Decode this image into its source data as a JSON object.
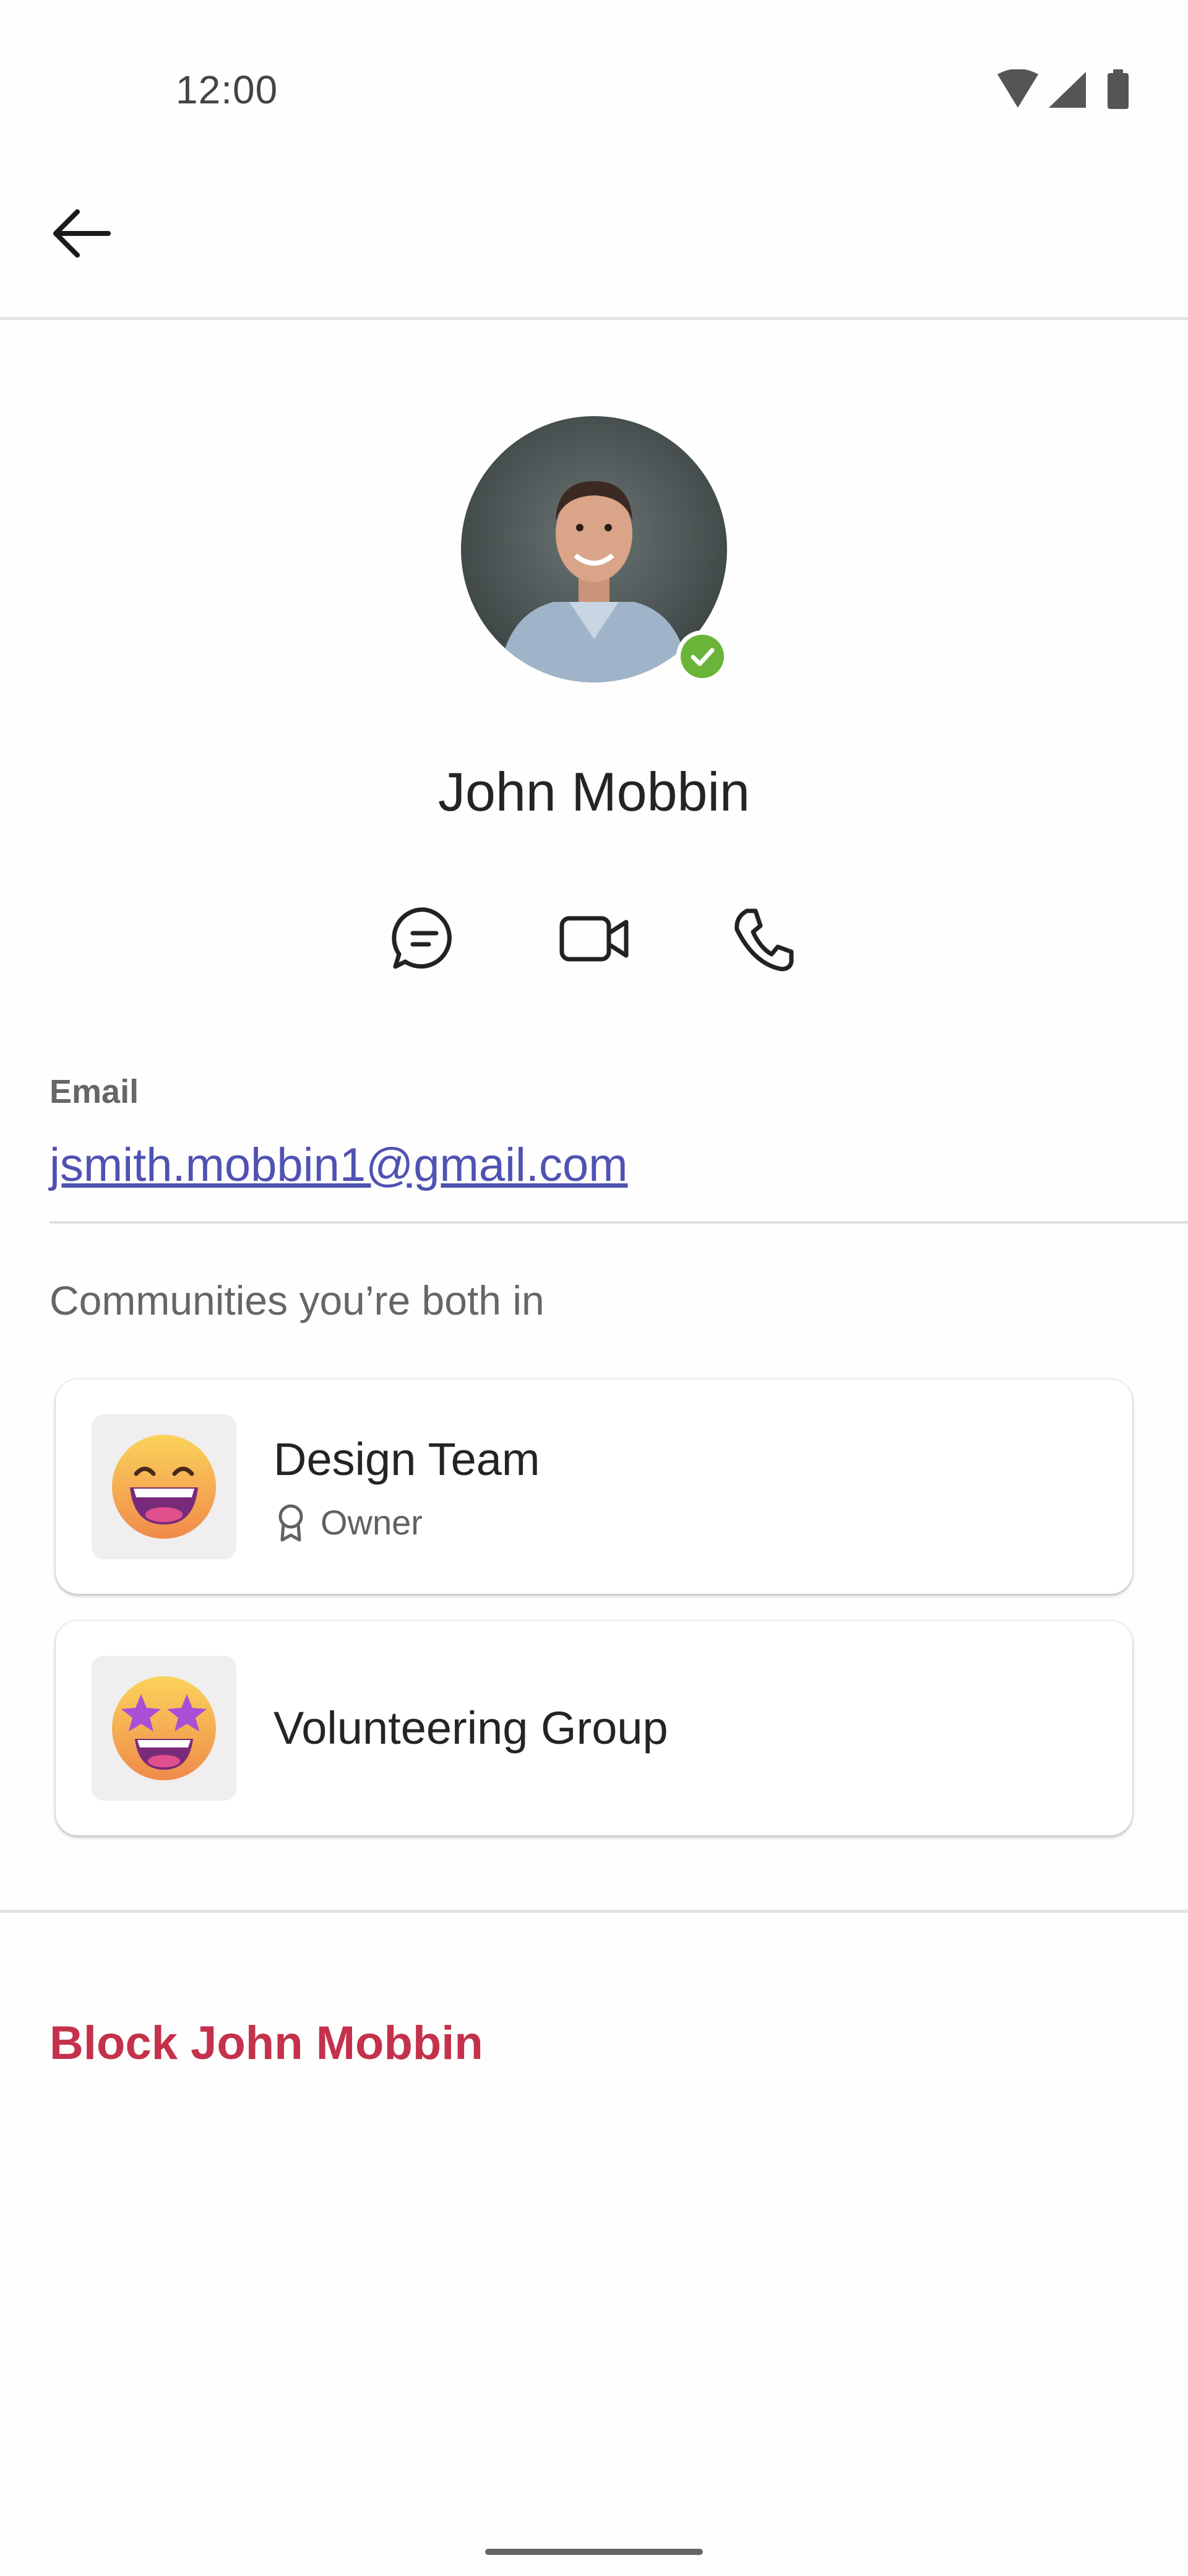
{
  "status_bar": {
    "time": "12:00",
    "icons": [
      "wifi-icon",
      "cellular-signal-icon",
      "battery-icon"
    ]
  },
  "app_bar": {
    "back_icon": "arrow-left-icon"
  },
  "profile": {
    "name": "John Mobbin",
    "presence": "available",
    "presence_color": "#6bb43a"
  },
  "actions": [
    {
      "name": "chat",
      "icon": "chat-icon"
    },
    {
      "name": "video-call",
      "icon": "video-camera-icon"
    },
    {
      "name": "audio-call",
      "icon": "phone-icon"
    }
  ],
  "email": {
    "label": "Email",
    "value": "jsmith.mobbin1@gmail.com",
    "link_color": "#4f52b2"
  },
  "communities": {
    "heading": "Communities you’re both in",
    "items": [
      {
        "name": "Design Team",
        "role": "Owner",
        "role_icon": "ribbon-icon",
        "emoji": "grinning-face-emoji"
      },
      {
        "name": "Volunteering Group",
        "emoji": "star-struck-emoji"
      }
    ]
  },
  "block": {
    "label": "Block John Mobbin",
    "color": "#c4314b"
  }
}
